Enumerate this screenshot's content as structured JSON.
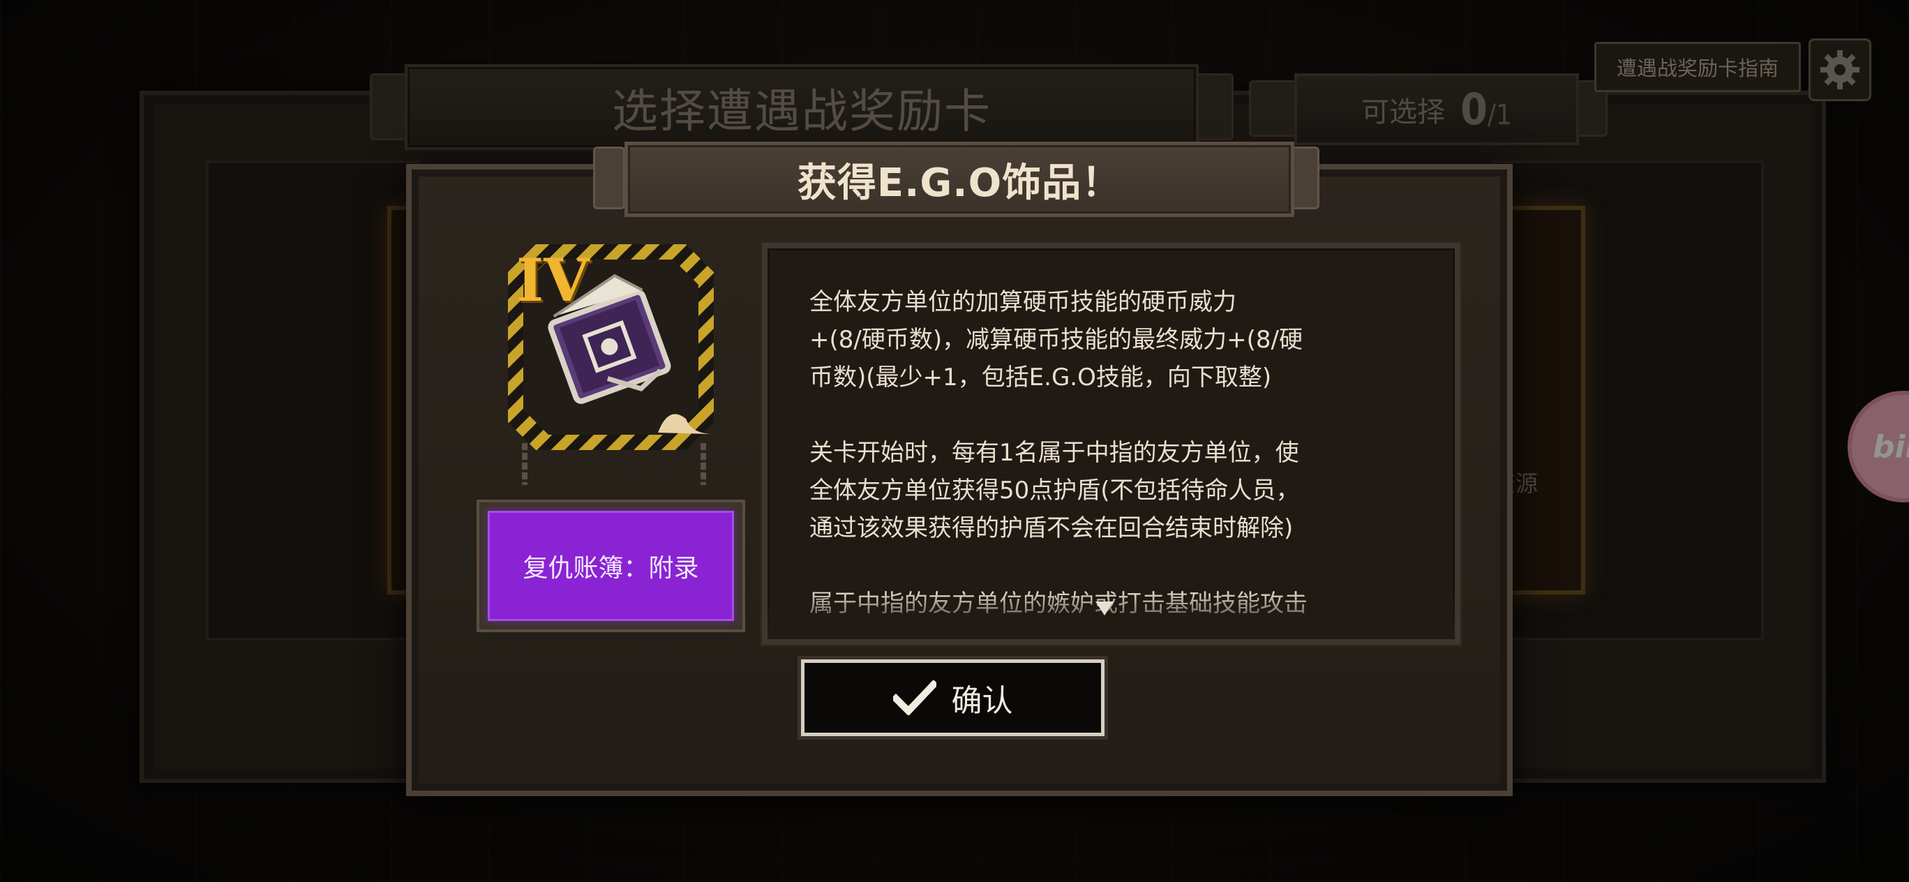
{
  "background": {
    "title": "选择遭遇战奖励卡",
    "select_label": "可选择",
    "select_count": "0",
    "select_max": "/1",
    "guide_button": "遭遇战奖励卡指南",
    "side_card_text": "资源",
    "bili_badge": "bili"
  },
  "modal": {
    "title": "获得E.G.O饰品！",
    "item": {
      "tier": "IV",
      "name": "复仇账簿：附录",
      "icon": "ledger-book-icon",
      "rarity_color": "#8a23d3"
    },
    "description": "全体友方单位的加算硬币技能的硬币威力\n+(8/硬币数)，减算硬币技能的最终威力+(8/硬\n币数)(最少+1，包括E.G.O技能，向下取整)\n\n关卡开始时，每有1名属于中指的友方单位，使\n全体友方单位获得50点护盾(不包括待命人员，\n通过该效果获得的护盾不会在回合结束时解除)\n\n属于中指的友方单位的嫉妒或打击基础技能攻击",
    "confirm_button": "确认",
    "accent_color": "#f1b530"
  }
}
